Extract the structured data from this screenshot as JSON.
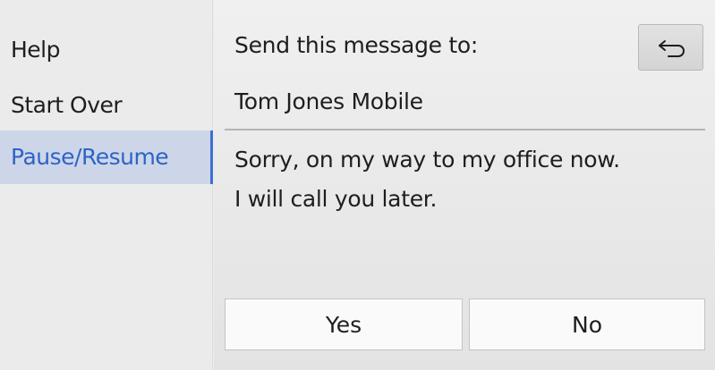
{
  "sidebar": {
    "items": [
      {
        "label": "Help",
        "active": false
      },
      {
        "label": "Start Over",
        "active": false
      },
      {
        "label": "Pause/Resume",
        "active": true
      }
    ]
  },
  "main": {
    "prompt": "Send this message to:",
    "recipient": "Tom Jones Mobile",
    "message_lines": [
      "Sorry, on my way to my office now.",
      "I will call you later."
    ],
    "back_icon": "return-arrow-icon",
    "buttons": {
      "yes_label": "Yes",
      "no_label": "No"
    }
  },
  "colors": {
    "active_text": "#2e63c8",
    "active_background": "#cdd6e8",
    "active_indicator": "#3d6fd4"
  }
}
